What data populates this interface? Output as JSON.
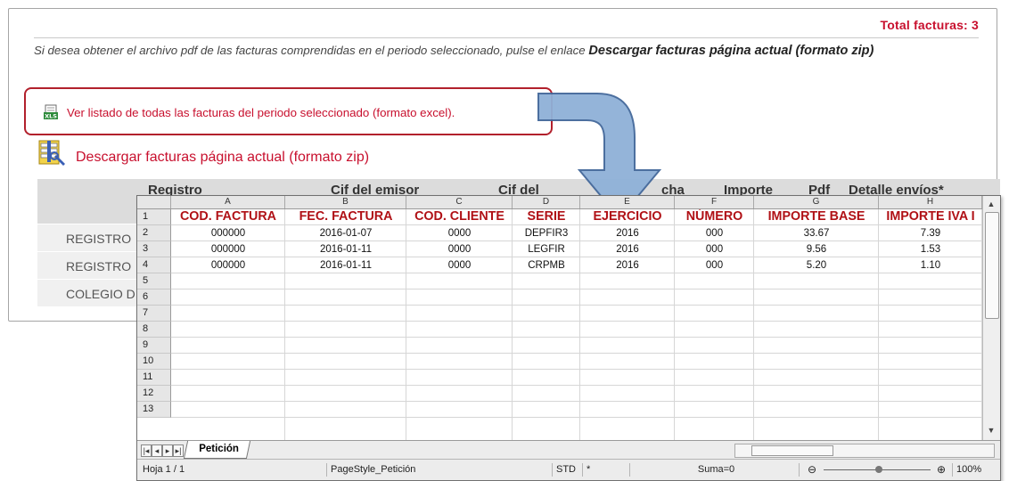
{
  "page": {
    "total_label": "Total facturas: 3",
    "intro_text": "Si desea obtener el archivo pdf de las facturas comprendidas en el periodo seleccionado, pulse el enlace",
    "intro_bold": "Descargar facturas página actual (formato zip)",
    "excel_link": "Ver listado de todas las facturas del periodo seleccionado (formato excel).",
    "zip_link": "Descargar facturas página actual (formato zip)",
    "table_headers": [
      "Registro",
      "Cif del emisor",
      "Cif del",
      "cha",
      "Importe",
      "Pdf",
      "Detalle envíos*"
    ],
    "rows": [
      "REGISTRO",
      "REGISTRO",
      "COLEGIO D"
    ],
    "icons": [
      "xls-file-icon",
      "zip-archive-icon",
      "arrow-icon"
    ],
    "accent_color": "#c8102e"
  },
  "spreadsheet": {
    "columns": [
      "A",
      "B",
      "C",
      "D",
      "E",
      "F",
      "G",
      "H"
    ],
    "row_numbers": [
      "1",
      "2",
      "3",
      "4",
      "5",
      "6",
      "7",
      "8",
      "9",
      "10",
      "11",
      "12",
      "13"
    ],
    "header_row": [
      "COD. FACTURA",
      "FEC. FACTURA",
      "COD. CLIENTE",
      "SERIE",
      "EJERCICIO",
      "NÚMERO",
      "IMPORTE BASE",
      "IMPORTE IVA I"
    ],
    "data": [
      [
        "000000",
        "2016-01-07",
        "0000",
        "DEPFIR3",
        "2016",
        "000",
        "33.67",
        "7.39"
      ],
      [
        "000000",
        "2016-01-11",
        "0000",
        "LEGFIR",
        "2016",
        "000",
        "9.56",
        "1.53"
      ],
      [
        "000000",
        "2016-01-11",
        "0000",
        "CRPMB",
        "2016",
        "000",
        "5.20",
        "1.10"
      ]
    ],
    "sheet_tab": "Petición",
    "status": {
      "page": "Hoja 1 / 1",
      "style": "PageStyle_Petición",
      "mode": "STD",
      "star": "*",
      "sum": "Suma=0",
      "zoom": "100%"
    },
    "header_color": "#b01116"
  }
}
